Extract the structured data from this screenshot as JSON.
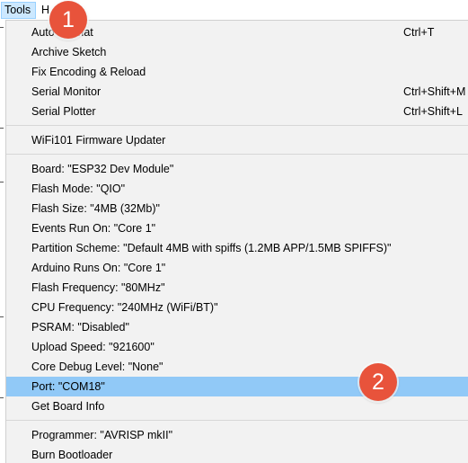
{
  "menubar": {
    "tools_label": "Tools",
    "help_label": "H"
  },
  "menu": {
    "items": [
      {
        "label": "Auto Format",
        "shortcut": "Ctrl+T"
      },
      {
        "label": "Archive Sketch",
        "shortcut": ""
      },
      {
        "label": "Fix Encoding & Reload",
        "shortcut": ""
      },
      {
        "label": "Serial Monitor",
        "shortcut": "Ctrl+Shift+M"
      },
      {
        "label": "Serial Plotter",
        "shortcut": "Ctrl+Shift+L"
      },
      {
        "label": "WiFi101 Firmware Updater",
        "shortcut": ""
      },
      {
        "label": "Board: \"ESP32 Dev Module\"",
        "shortcut": ""
      },
      {
        "label": "Flash Mode: \"QIO\"",
        "shortcut": ""
      },
      {
        "label": "Flash Size: \"4MB (32Mb)\"",
        "shortcut": ""
      },
      {
        "label": "Events Run On: \"Core 1\"",
        "shortcut": ""
      },
      {
        "label": "Partition Scheme: \"Default 4MB with spiffs (1.2MB APP/1.5MB SPIFFS)\"",
        "shortcut": ""
      },
      {
        "label": "Arduino Runs On: \"Core 1\"",
        "shortcut": ""
      },
      {
        "label": "Flash Frequency: \"80MHz\"",
        "shortcut": ""
      },
      {
        "label": "CPU Frequency: \"240MHz (WiFi/BT)\"",
        "shortcut": ""
      },
      {
        "label": "PSRAM: \"Disabled\"",
        "shortcut": ""
      },
      {
        "label": "Upload Speed: \"921600\"",
        "shortcut": ""
      },
      {
        "label": "Core Debug Level: \"None\"",
        "shortcut": ""
      },
      {
        "label": "Port: \"COM18\"",
        "shortcut": ""
      },
      {
        "label": "Get Board Info",
        "shortcut": ""
      },
      {
        "label": "Programmer: \"AVRISP mkII\"",
        "shortcut": ""
      },
      {
        "label": "Burn Bootloader",
        "shortcut": ""
      }
    ]
  },
  "annotations": {
    "badge_1": "1",
    "badge_2": "2"
  },
  "colors": {
    "highlight": "#91c9f7",
    "badge": "#e8533b"
  }
}
